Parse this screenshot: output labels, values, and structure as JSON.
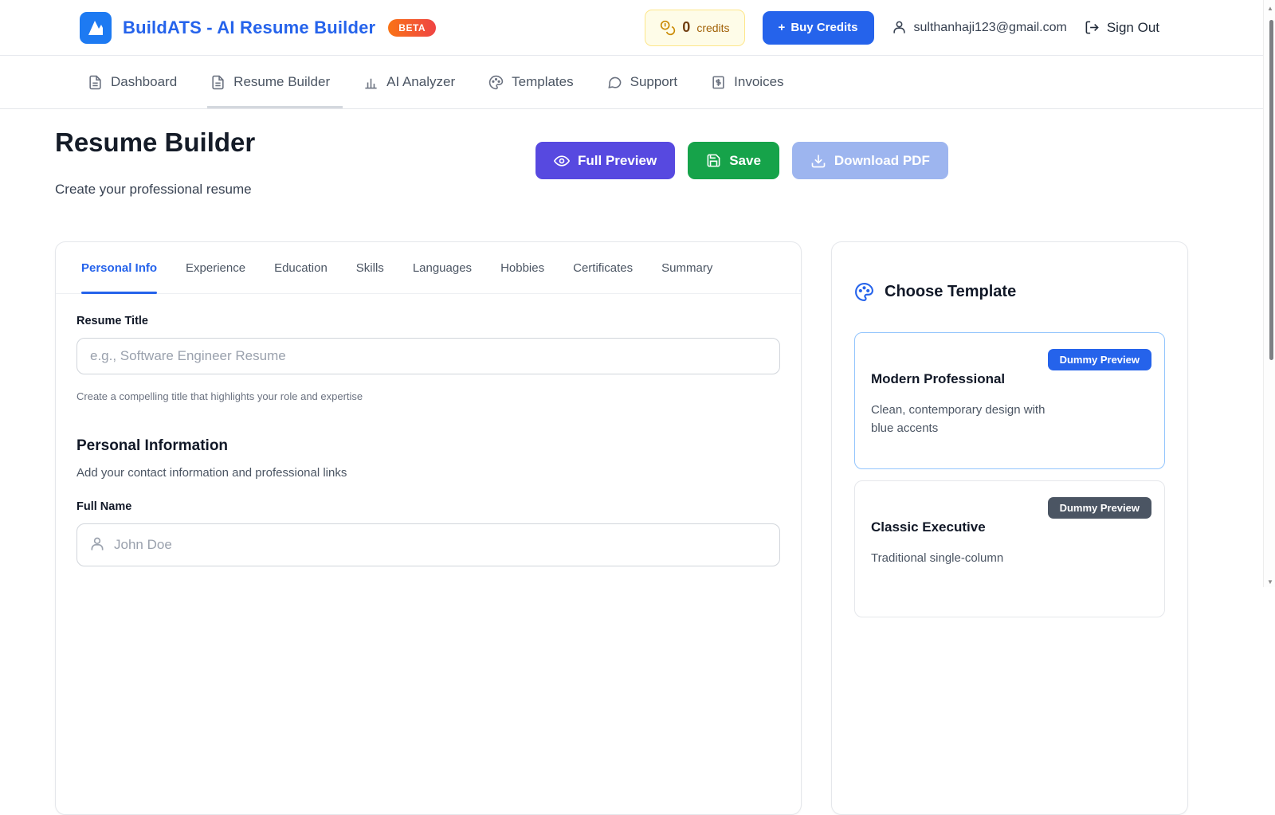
{
  "header": {
    "brand": "BuildATS - AI Resume Builder",
    "beta": "BETA",
    "credits": {
      "count": "0",
      "label": "credits"
    },
    "buy_credits": {
      "plus": "+",
      "label": "Buy Credits"
    },
    "user_email": "sulthanhaji123@gmail.com",
    "sign_out": "Sign Out"
  },
  "nav": {
    "items": [
      {
        "label": "Dashboard",
        "icon": "file-icon"
      },
      {
        "label": "Resume Builder",
        "icon": "file-icon",
        "active": true
      },
      {
        "label": "AI Analyzer",
        "icon": "bar-chart-icon"
      },
      {
        "label": "Templates",
        "icon": "palette-icon"
      },
      {
        "label": "Support",
        "icon": "chat-bubble-icon"
      },
      {
        "label": "Invoices",
        "icon": "invoice-icon"
      }
    ]
  },
  "page": {
    "title": "Resume Builder",
    "subtitle": "Create your professional resume",
    "actions": {
      "full_preview": "Full Preview",
      "save": "Save",
      "download_pdf": "Download PDF"
    }
  },
  "form": {
    "tabs": [
      "Personal Info",
      "Experience",
      "Education",
      "Skills",
      "Languages",
      "Hobbies",
      "Certificates",
      "Summary"
    ],
    "active_tab": "Personal Info",
    "resume_title": {
      "label": "Resume Title",
      "placeholder": "e.g., Software Engineer Resume",
      "value": "",
      "helper": "Create a compelling title that highlights your role and expertise"
    },
    "personal_information": {
      "heading": "Personal Information",
      "subheading": "Add your contact information and professional links",
      "full_name": {
        "label": "Full Name",
        "placeholder": "John Doe",
        "value": ""
      }
    }
  },
  "templates": {
    "heading": "Choose Template",
    "cards": [
      {
        "name": "Modern Professional",
        "badge": "Dummy Preview",
        "badge_style": "blue",
        "description": "Clean, contemporary design with blue accents",
        "selected": true
      },
      {
        "name": "Classic Executive",
        "badge": "Dummy Preview",
        "badge_style": "dark",
        "description": "Traditional single-column",
        "selected": false
      }
    ]
  },
  "colors": {
    "brand_blue": "#2563eb",
    "beta_gradient_from": "#f97316",
    "beta_gradient_to": "#ef4444",
    "full_preview_purple": "#5749e0",
    "save_green": "#16a34a",
    "download_disabled_blue": "#9db5ef",
    "credits_bg": "#fefce8",
    "credits_border": "#fde68a",
    "credits_amber": "#a16207",
    "badge_blue": "#2563eb",
    "badge_dark": "#4b5563",
    "selected_card_border": "#93c5fd",
    "active_tab_blue": "#2563eb"
  }
}
